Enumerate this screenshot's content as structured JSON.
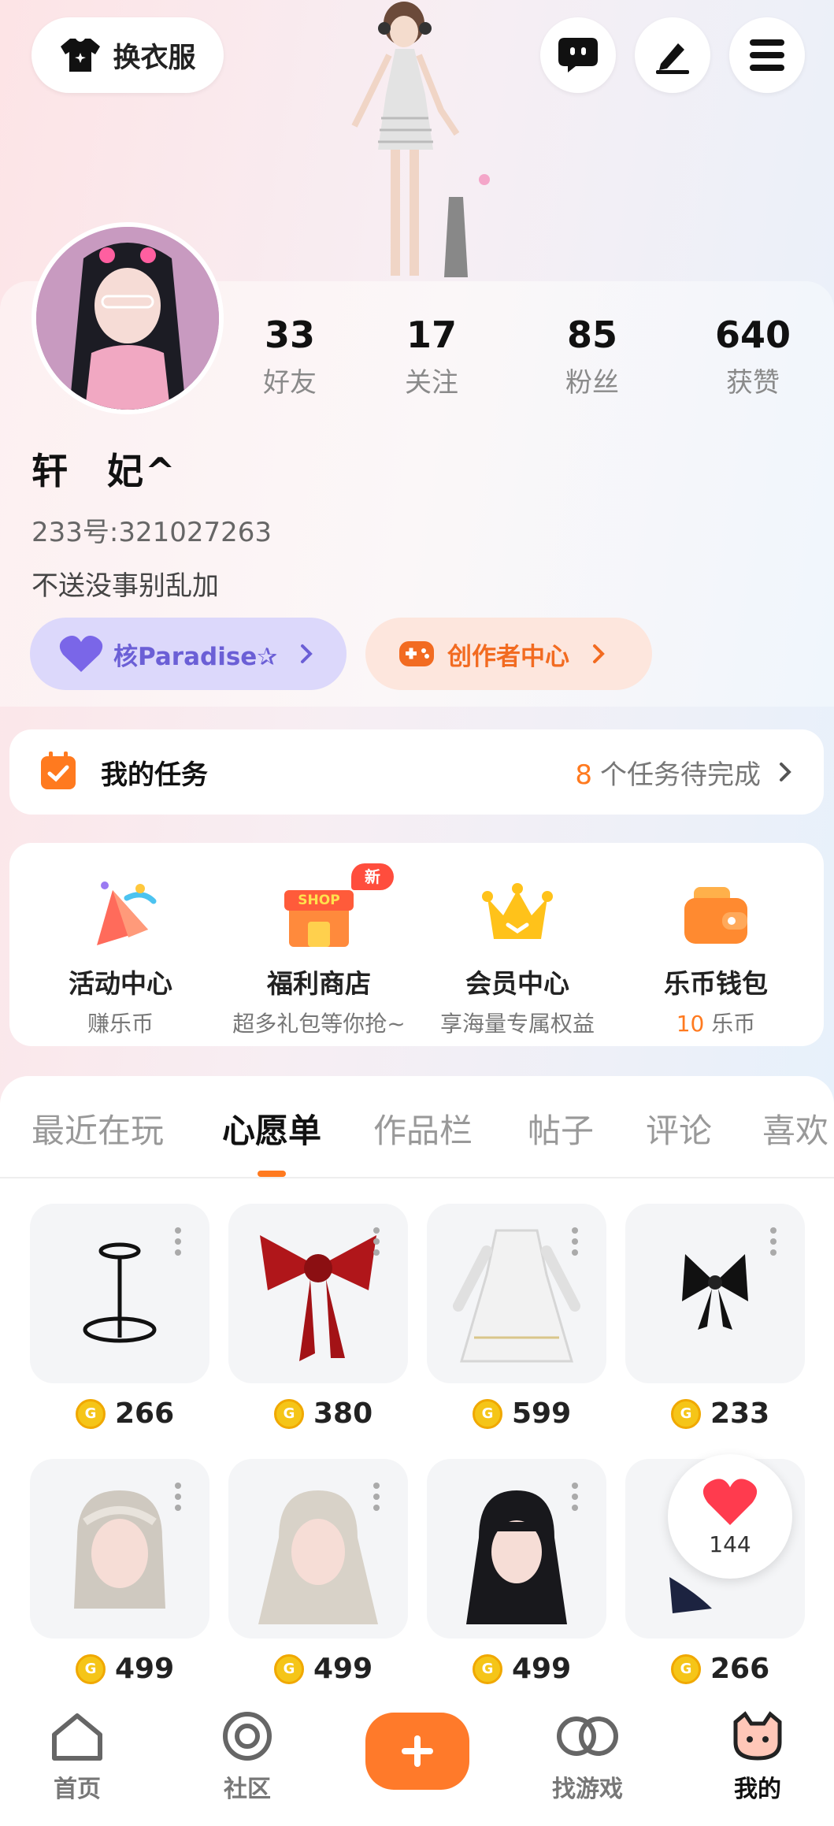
{
  "header": {
    "wardrobe_label": "换衣服"
  },
  "profile": {
    "stats": [
      {
        "num": "33",
        "label": "好友"
      },
      {
        "num": "17",
        "label": "关注"
      },
      {
        "num": "85",
        "label": "粉丝"
      },
      {
        "num": "640",
        "label": "获赞"
      }
    ],
    "nickname": "轩　妃^",
    "uid": "233号:321027263",
    "bio": "不送没事别乱加",
    "badge_core": "核Paradise✰",
    "badge_creator": "创作者中心"
  },
  "tasks": {
    "title": "我的任务",
    "count": "8",
    "suffix": "个任务待完成"
  },
  "features": [
    {
      "title": "活动中心",
      "sub": "赚乐币",
      "icon": "party-icon"
    },
    {
      "title": "福利商店",
      "sub": "超多礼包等你抢~",
      "icon": "shop-icon",
      "badge": "新",
      "shop_text": "SHOP"
    },
    {
      "title": "会员中心",
      "sub": "享海量专属权益",
      "icon": "crown-icon"
    },
    {
      "title": "乐币钱包",
      "sub_num": "10",
      "sub_unit": "乐币",
      "icon": "wallet-icon"
    }
  ],
  "tabs": [
    "最近在玩",
    "心愿单",
    "作品栏",
    "帖子",
    "评论",
    "喜欢"
  ],
  "active_tab": "心愿单",
  "wishlist": [
    {
      "name": "choker-item",
      "price": "266"
    },
    {
      "name": "red-bow-item",
      "price": "380"
    },
    {
      "name": "white-dress-item",
      "price": "599"
    },
    {
      "name": "black-bow-item",
      "price": "233"
    },
    {
      "name": "braided-hair-item",
      "price": "499"
    },
    {
      "name": "long-hair-item",
      "price": "499"
    },
    {
      "name": "black-hair-item",
      "price": "499"
    },
    {
      "name": "sailor-item",
      "price": "266"
    }
  ],
  "likes_count": "144",
  "nav": [
    {
      "label": "首页"
    },
    {
      "label": "社区"
    },
    {
      "label": "找游戏"
    },
    {
      "label": "我的"
    }
  ],
  "colors": {
    "accent": "#ff7a2a",
    "core_badge": "#6b5fd6",
    "creator_badge": "#f26b21"
  }
}
